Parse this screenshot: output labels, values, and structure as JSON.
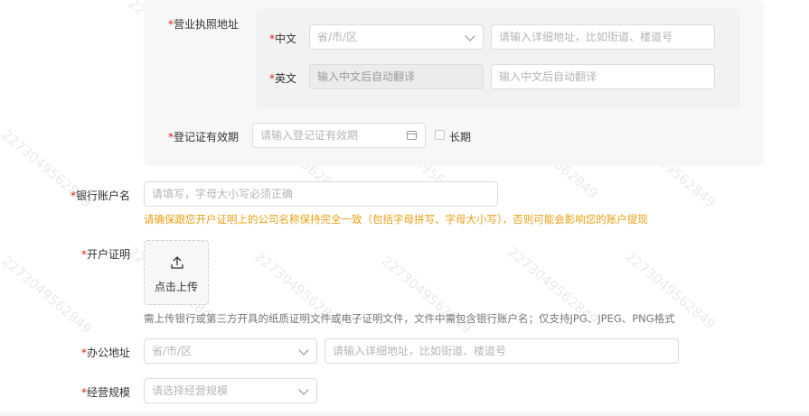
{
  "business_address": {
    "label": "营业执照地址",
    "chinese": {
      "label": "中文",
      "region_placeholder": "省/市/区",
      "detail_placeholder": "请输入详细地址，比如街道、楼道号"
    },
    "english": {
      "label": "英文",
      "region_placeholder": "输入中文后自动翻译",
      "detail_placeholder": "输入中文后自动翻译"
    }
  },
  "registration_validity": {
    "label": "登记证有效期",
    "placeholder": "请输入登记证有效期",
    "long_term_label": "长期"
  },
  "bank_account_name": {
    "label": "银行账户名",
    "placeholder": "请填写，字母大小写必须正确",
    "warning": "请确保跟您开户证明上的公司名称保持完全一致（包括字母拼写、字母大小写），否则可能会影响您的账户提现"
  },
  "account_certificate": {
    "label": "开户证明",
    "upload_label": "点击上传",
    "note": "需上传银行或第三方开具的纸质证明文件或电子证明文件，文件中需包含银行账户名；仅支持JPG、JPEG、PNG格式"
  },
  "office_address": {
    "label": "办公地址",
    "region_placeholder": "省/市/区",
    "detail_placeholder": "请输入详细地址，比如街道、楼道号"
  },
  "business_scale": {
    "label": "经营规模",
    "placeholder": "请选择经营规模"
  },
  "required_mark": "*",
  "watermark_text": "2273049562849",
  "colors": {
    "required": "#e02020",
    "warning": "#e8a017"
  }
}
